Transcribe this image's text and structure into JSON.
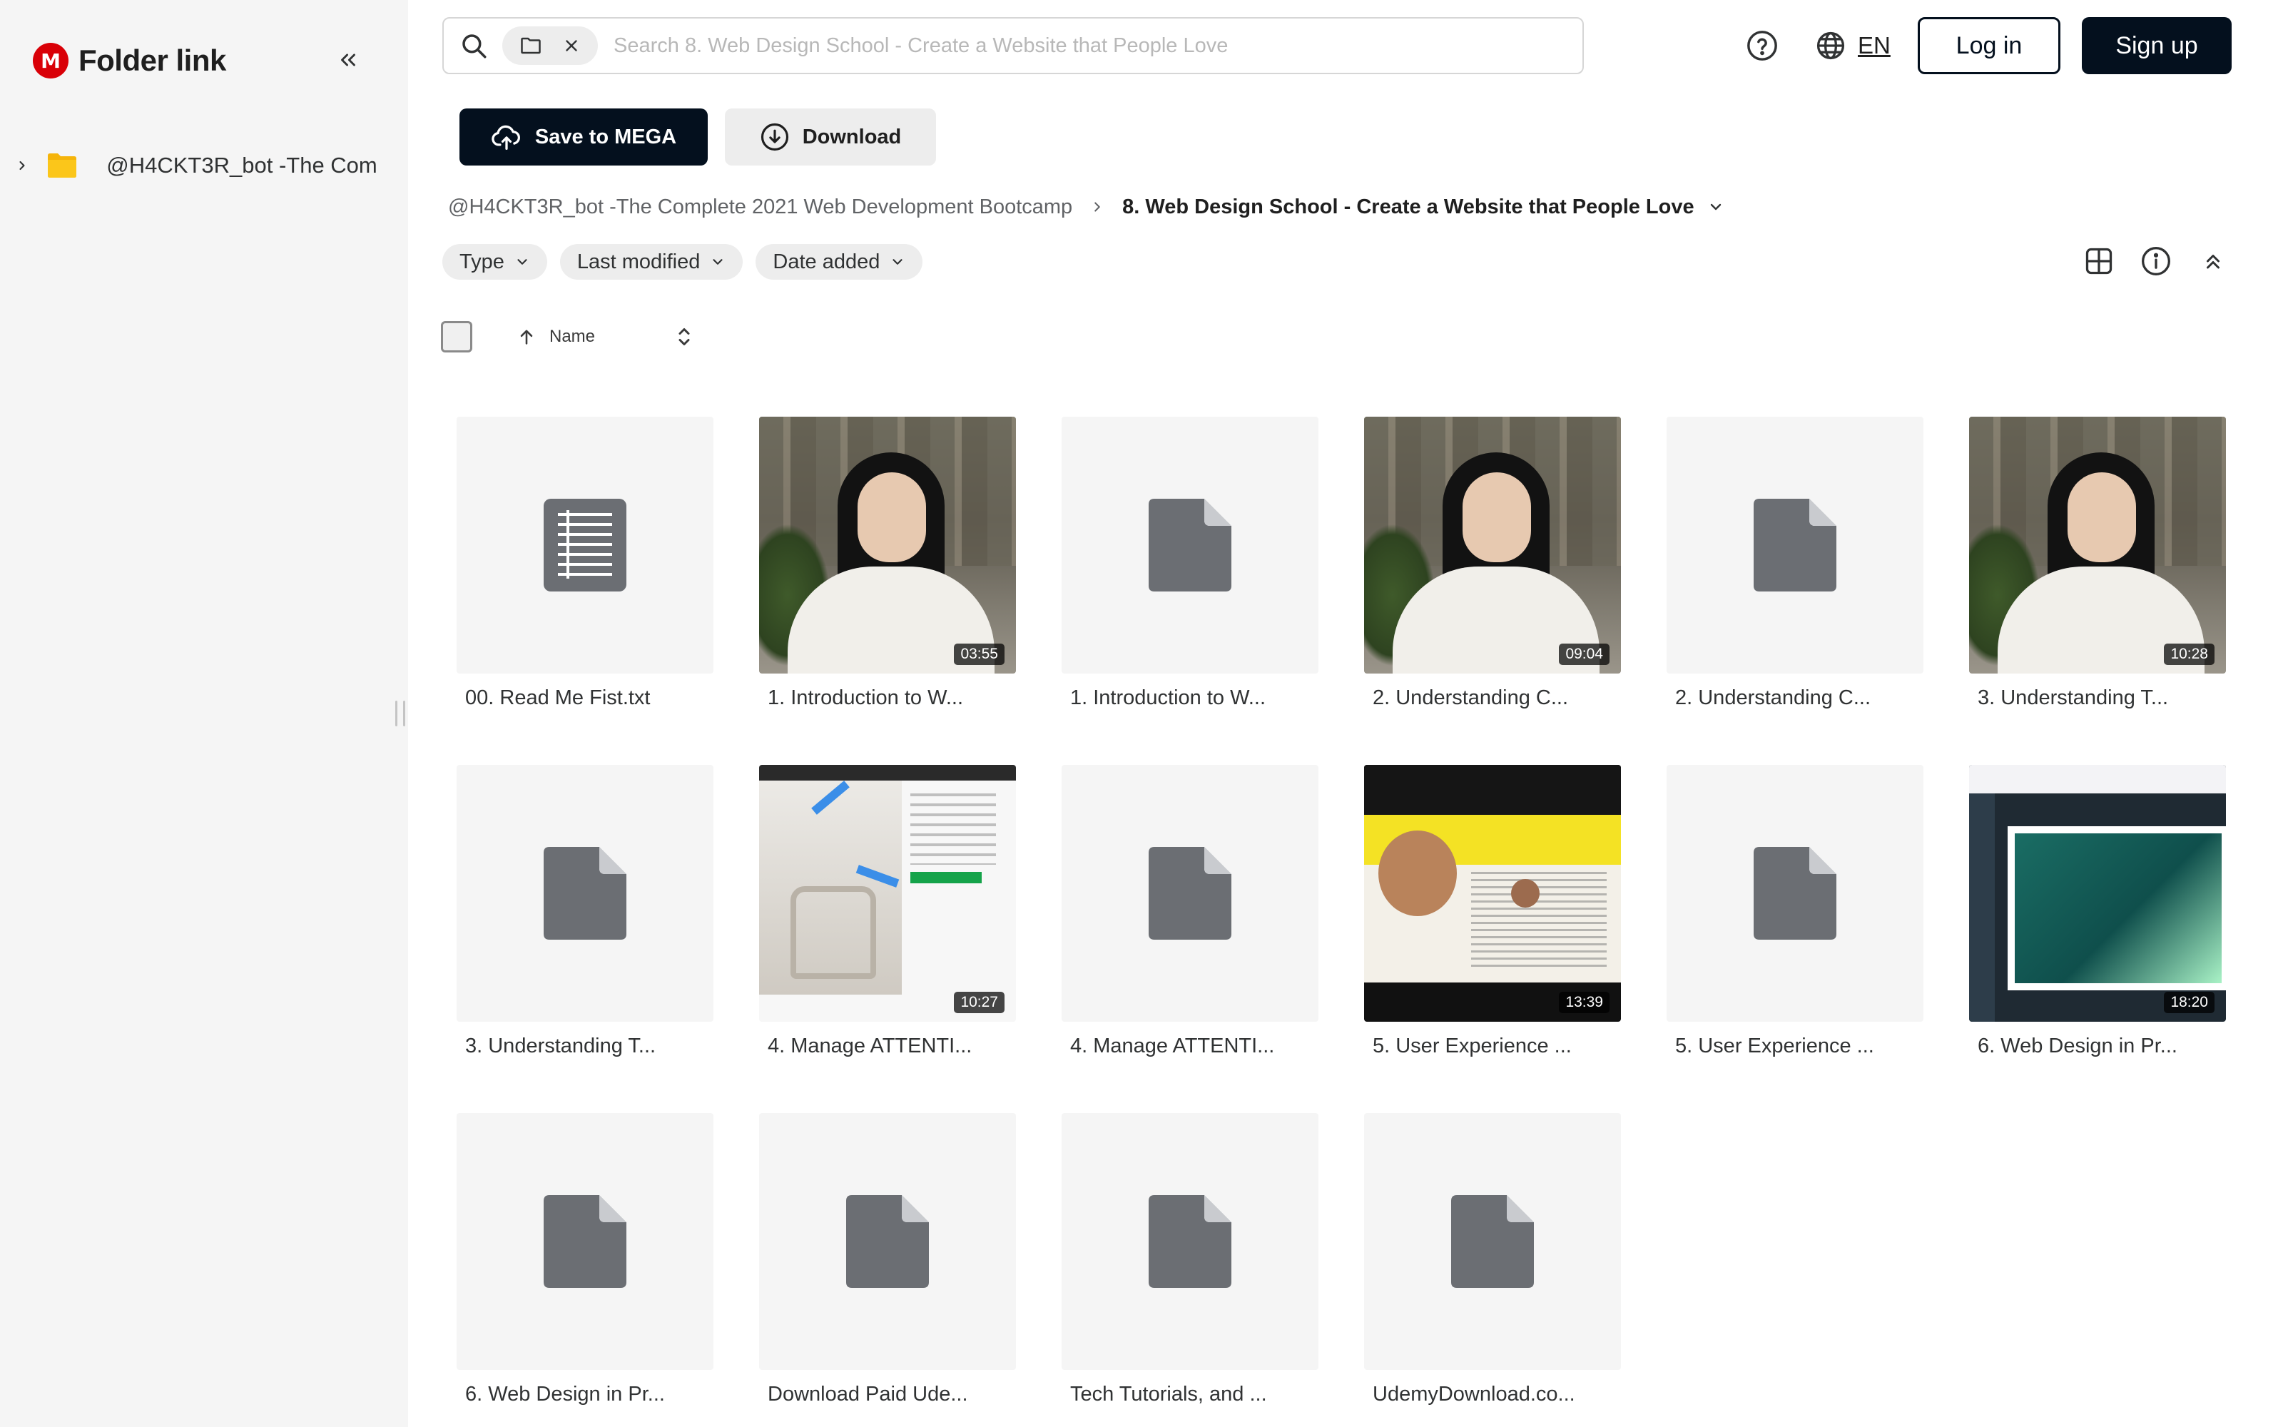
{
  "sidebar": {
    "brand_logo_letter": "M",
    "brand_title": "Folder link",
    "tree_item_label": "@H4CKT3R_bot -The Com"
  },
  "search": {
    "placeholder": "Search 8. Web Design School - Create a Website that People Love"
  },
  "header": {
    "lang_label": "EN",
    "login_label": "Log in",
    "signup_label": "Sign up"
  },
  "actions": {
    "save_label": "Save to MEGA",
    "download_label": "Download"
  },
  "breadcrumb": {
    "root": "@H4CKT3R_bot -The Complete 2021 Web Development Bootcamp",
    "current": "8. Web Design School - Create a Website that People Love"
  },
  "filters": {
    "type": "Type",
    "last_modified": "Last modified",
    "date_added": "Date added"
  },
  "sort": {
    "name_label": "Name"
  },
  "files": [
    {
      "name": "00. Read Me Fist.txt",
      "kind": "text",
      "duration": ""
    },
    {
      "name": "1. Introduction to W...",
      "kind": "video-person",
      "duration": "03:55"
    },
    {
      "name": "1. Introduction to W...",
      "kind": "generic",
      "duration": ""
    },
    {
      "name": "2. Understanding C...",
      "kind": "video-person",
      "duration": "09:04"
    },
    {
      "name": "2. Understanding C...",
      "kind": "generic",
      "duration": ""
    },
    {
      "name": "3. Understanding T...",
      "kind": "video-person",
      "duration": "10:28"
    },
    {
      "name": "3. Understanding T...",
      "kind": "generic",
      "duration": ""
    },
    {
      "name": "4. Manage ATTENTI...",
      "kind": "video-shop",
      "duration": "10:27"
    },
    {
      "name": "4. Manage ATTENTI...",
      "kind": "generic",
      "duration": ""
    },
    {
      "name": "5. User Experience ...",
      "kind": "video-news",
      "duration": "13:39"
    },
    {
      "name": "5. User Experience ...",
      "kind": "generic",
      "duration": ""
    },
    {
      "name": "6. Web Design in Pr...",
      "kind": "video-design",
      "duration": "18:20"
    },
    {
      "name": "6. Web Design in Pr...",
      "kind": "generic",
      "duration": ""
    },
    {
      "name": "Download Paid Ude...",
      "kind": "generic",
      "duration": ""
    },
    {
      "name": "Tech Tutorials, and ...",
      "kind": "generic",
      "duration": ""
    },
    {
      "name": "UdemyDownload.co...",
      "kind": "generic",
      "duration": ""
    }
  ],
  "colors": {
    "brand_red": "#d90007",
    "primary_dark": "#04101e",
    "icon_gray": "#6b6e73"
  }
}
